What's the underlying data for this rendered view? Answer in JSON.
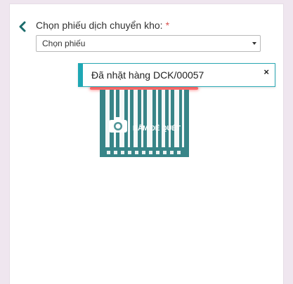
{
  "form": {
    "label": "Chọn phiếu dịch chuyển kho:",
    "required_mark": "*",
    "select_value": "Chọn phiếu"
  },
  "scanner": {
    "label": "BẤM ĐỂ QUÉT",
    "icon": "camera-icon",
    "bar_color": "#0d6b6e",
    "scan_line_color": "#ff6b6b"
  },
  "notification": {
    "message": "Đã nhặt hàng DCK/00057",
    "close_symbol": "×",
    "accent_color": "#1ea7b4"
  },
  "colors": {
    "back_icon": "#1b6b6b",
    "required": "#d9534f"
  }
}
